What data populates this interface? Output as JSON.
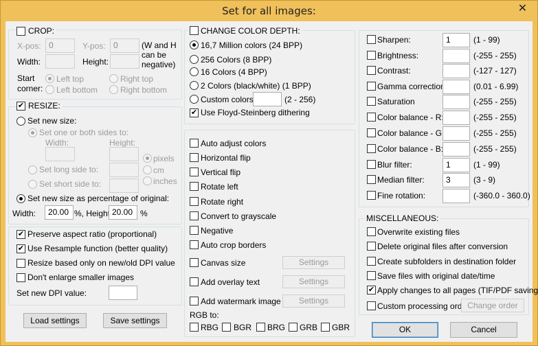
{
  "window": {
    "title": "Set for all images:",
    "close_glyph": "✕"
  },
  "crop": {
    "label": "CROP:",
    "checked": false,
    "xpos_label": "X-pos:",
    "xpos_value": "0",
    "ypos_label": "Y-pos:",
    "ypos_value": "0",
    "width_label": "Width:",
    "width_value": "",
    "height_label": "Height:",
    "height_value": "",
    "note_line1": "(W and H",
    "note_line2": "can be",
    "note_line3": "negative)",
    "start_label1": "Start",
    "start_label2": "corner:",
    "corners": [
      "Left top",
      "Right top",
      "Left bottom",
      "Right bottom"
    ]
  },
  "resize": {
    "label": "RESIZE:",
    "checked": true,
    "new_size_label": "Set new size:",
    "one_or_both_label": "Set one or both sides to:",
    "width_label": "Width:",
    "height_label": "Height:",
    "width_value": "",
    "height_value": "",
    "units": [
      "pixels",
      "cm",
      "inches"
    ],
    "long_side_label": "Set long side to:",
    "long_side_value": "",
    "short_side_label": "Set short side to:",
    "short_side_value": "",
    "percentage_label": "Set new size as percentage of original:",
    "pct_width_label": "Width:",
    "pct_width_value": "20.00",
    "pct_height_label": "%, Height:",
    "pct_height_value": "20.00",
    "pct_suffix": "%"
  },
  "options": {
    "preserve_aspect": "Preserve aspect ratio (proportional)",
    "use_resample": "Use Resample function (better quality)",
    "resize_dpi": "Resize based only on new/old DPI value",
    "dont_enlarge": "Don't enlarge smaller images",
    "dpi_label": "Set new DPI value:",
    "dpi_value": ""
  },
  "buttons": {
    "load": "Load settings",
    "save": "Save settings",
    "ok": "OK",
    "cancel": "Cancel",
    "settings": "Settings",
    "change_order": "Change order"
  },
  "color_depth": {
    "label": "CHANGE COLOR DEPTH:",
    "checked": false,
    "options": [
      "16,7 Million colors (24 BPP)",
      "256 Colors (8 BPP)",
      "16 Colors (4 BPP)",
      "2 Colors (black/white) (1 BPP)",
      "Custom colors:"
    ],
    "custom_value": "",
    "custom_range": "(2 - 256)",
    "dithering": "Use Floyd-Steinberg dithering"
  },
  "transforms": {
    "items": [
      "Auto adjust colors",
      "Horizontal flip",
      "Vertical flip",
      "Rotate left",
      "Rotate right",
      "Convert to grayscale",
      "Negative",
      "Auto crop borders"
    ],
    "canvas": "Canvas size",
    "overlay": "Add overlay text",
    "watermark": "Add watermark image",
    "rgb_label": "RGB to:",
    "rgb_options": [
      "RBG",
      "BGR",
      "BRG",
      "GRB",
      "GBR"
    ]
  },
  "filters": [
    {
      "label": "Sharpen:",
      "value": "1",
      "range": "(1  -  99)"
    },
    {
      "label": "Brightness:",
      "value": "",
      "range": "(-255  -  255)"
    },
    {
      "label": "Contrast:",
      "value": "",
      "range": "(-127  -  127)"
    },
    {
      "label": "Gamma correction:",
      "value": "",
      "range": "(0.01  -  6.99)"
    },
    {
      "label": "Saturation",
      "value": "",
      "range": "(-255  -  255)"
    },
    {
      "label": "Color balance - R:",
      "value": "",
      "range": "(-255  -  255)"
    },
    {
      "label": "Color balance - G:",
      "value": "",
      "range": "(-255  -  255)"
    },
    {
      "label": "Color balance - B:",
      "value": "",
      "range": "(-255  -  255)"
    },
    {
      "label": "Blur filter:",
      "value": "1",
      "range": "(1  -  99)"
    },
    {
      "label": "Median filter:",
      "value": "3",
      "range": "(3  -  9)"
    },
    {
      "label": "Fine rotation:",
      "value": "",
      "range": "(-360.0  -  360.0)"
    }
  ],
  "misc": {
    "label": "MISCELLANEOUS:",
    "items": [
      "Overwrite existing files",
      "Delete original files after conversion",
      "Create subfolders in destination folder",
      "Save files with original date/time",
      "Apply changes to all pages (TIF/PDF saving)",
      "Custom processing order"
    ]
  },
  "colors": {
    "title_bar": "#f0c05a",
    "client": "#f0f0f0",
    "group_border": "#d5dfe5",
    "default_button_border": "#3c7fb1"
  }
}
